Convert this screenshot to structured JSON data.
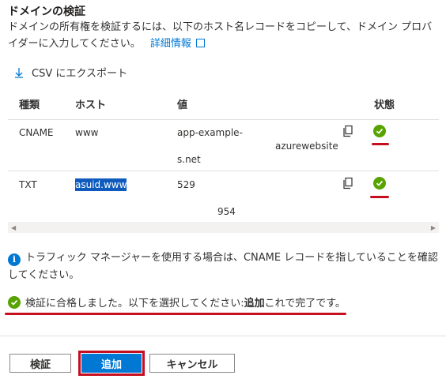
{
  "section": {
    "title": "ドメインの検証",
    "description_line1": "ドメインの所有権を検証するには、以下のホスト名レコードをコピーして、ドメイン プロバ",
    "description_line2_prefix": "イダーに入力してください。",
    "details_link": "詳細情報"
  },
  "toolbar": {
    "export_label": "CSV にエクスポート"
  },
  "table": {
    "headers": {
      "type": "種類",
      "host": "ホスト",
      "value": "値",
      "status": "状態"
    },
    "rows": [
      {
        "type": "CNAME",
        "host": "www",
        "value_part1": "app-example-",
        "value_part2": "azurewebsite",
        "value_part3": "s.net",
        "status": "verified"
      },
      {
        "type": "TXT",
        "host": "asuid.www",
        "value_part1": "529",
        "value_part2": "954",
        "status": "verified"
      }
    ]
  },
  "info": {
    "text": "トラフィック マネージャーを使用する場合は、CNAME レコードを指していることを確認してください。"
  },
  "success": {
    "prefix": "検証に合格しました。以下を選択してください: ",
    "bold": "追加",
    "suffix": "これで完了です。"
  },
  "buttons": {
    "validate": "検証",
    "add": "追加",
    "cancel": "キャンセル"
  },
  "colors": {
    "accent": "#0078d4",
    "success": "#57a300",
    "highlight": "#c50f1f"
  }
}
